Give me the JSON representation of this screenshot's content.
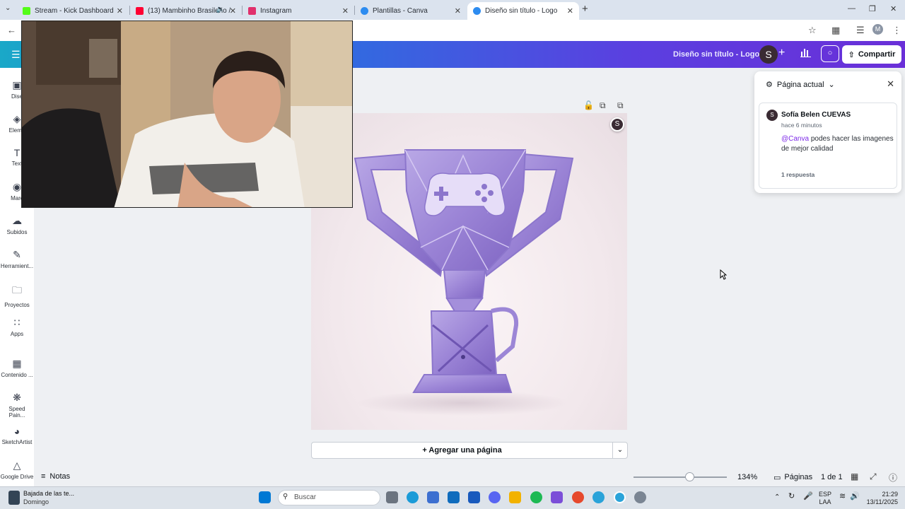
{
  "browser": {
    "tabs": [
      {
        "title": "Stream - Kick Dashboard",
        "color": "#53fc18"
      },
      {
        "title": "(13) Mambinho Brasileño /",
        "color": "#ff0033"
      },
      {
        "title": "Instagram",
        "color": "#e1306c"
      },
      {
        "title": "Plantillas - Canva",
        "color": "#2d8cf0"
      },
      {
        "title": "Diseño sin título - Logo",
        "color": "#2d8cf0"
      }
    ],
    "profile_initial": "M"
  },
  "header": {
    "doc_title": "Diseño sin título - Logo",
    "avatar_initial": "S",
    "share_label": "Compartir"
  },
  "sidebar": {
    "items": [
      {
        "label": "Dise",
        "icon": "design-icon"
      },
      {
        "label": "Eleme",
        "icon": "elements-icon"
      },
      {
        "label": "Text",
        "icon": "text-icon"
      },
      {
        "label": "Marc",
        "icon": "brand-icon"
      },
      {
        "label": "Subidos",
        "icon": "upload-icon"
      },
      {
        "label": "Herramient...",
        "icon": "tools-icon"
      },
      {
        "label": "Proyectos",
        "icon": "folder-icon"
      },
      {
        "label": "Apps",
        "icon": "apps-icon"
      },
      {
        "label": "Contenido ...",
        "icon": "content-icon"
      },
      {
        "label": "Speed Pain...",
        "icon": "speed-paint-icon"
      },
      {
        "label": "SketchArtist",
        "icon": "sketch-artist-icon"
      },
      {
        "label": "Google Drive",
        "icon": "google-drive-icon"
      }
    ]
  },
  "canvas": {
    "page_avatar_initial": "S",
    "add_page_label": "+ Agregar una página"
  },
  "comments": {
    "header": "Página actual",
    "author": "Sofía Belen CUEVAS",
    "author_initial": "S",
    "time": "hace 6 minutos",
    "mention": "@Canva",
    "text": " podes hacer las imagenes de mejor calidad",
    "replies": "1 respuesta"
  },
  "status": {
    "notes_label": "Notas",
    "zoom": "134%",
    "zoom_fraction": 0.6,
    "pages_label": "Páginas",
    "page_count": "1 de 1"
  },
  "taskbar": {
    "news_title": "Bajada de las te...",
    "news_sub": "Domingo",
    "search_placeholder": "Buscar",
    "lang1": "ESP",
    "lang2": "LAA",
    "time": "21:29",
    "date": "13/11/2025"
  }
}
